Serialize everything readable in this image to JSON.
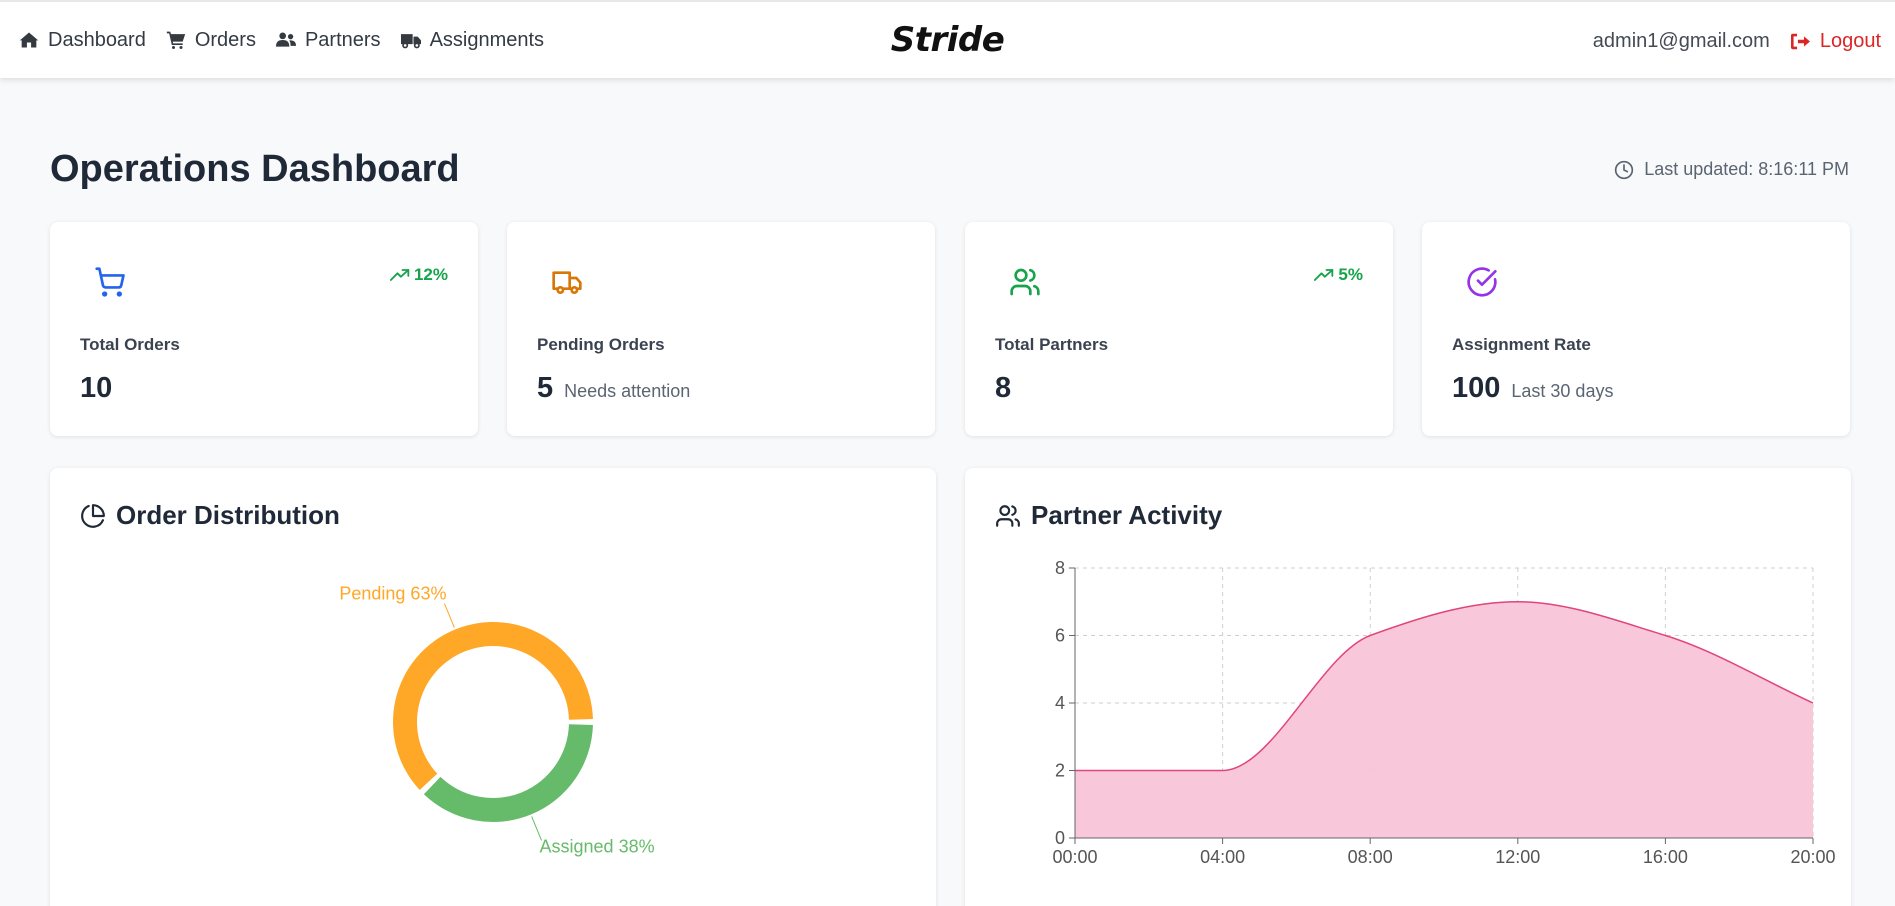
{
  "nav": {
    "items": [
      {
        "label": "Dashboard",
        "icon": "home-icon"
      },
      {
        "label": "Orders",
        "icon": "cart-icon"
      },
      {
        "label": "Partners",
        "icon": "users-icon"
      },
      {
        "label": "Assignments",
        "icon": "truck-icon"
      }
    ],
    "brand": "Stride",
    "user_email": "admin1@gmail.com",
    "logout_label": "Logout"
  },
  "header": {
    "title": "Operations Dashboard",
    "last_updated": "Last updated: 8:16:11 PM"
  },
  "stats": [
    {
      "label": "Total Orders",
      "value": "10",
      "sub": "",
      "trend": "12%",
      "icon": "cart-outline-icon",
      "color": "#2563eb"
    },
    {
      "label": "Pending Orders",
      "value": "5",
      "sub": "Needs attention",
      "trend": "",
      "icon": "truck-outline-icon",
      "color": "#d97706"
    },
    {
      "label": "Total Partners",
      "value": "8",
      "sub": "",
      "trend": "5%",
      "icon": "users-outline-icon",
      "color": "#16a34a"
    },
    {
      "label": "Assignment Rate",
      "value": "100",
      "sub": "Last 30 days",
      "trend": "",
      "icon": "check-circle-icon",
      "color": "#9333ea"
    }
  ],
  "order_panel": {
    "title": "Order Distribution",
    "icon": "pie-chart-icon"
  },
  "partner_panel": {
    "title": "Partner Activity",
    "icon": "users-outline-icon"
  },
  "chart_data": [
    {
      "type": "pie",
      "title": "Order Distribution",
      "slices": [
        {
          "label": "Pending",
          "value": 63,
          "display": "Pending 63%",
          "color": "#ffa726"
        },
        {
          "label": "Assigned",
          "value": 38,
          "display": "Assigned 38%",
          "color": "#66bb6a"
        }
      ]
    },
    {
      "type": "area",
      "title": "Partner Activity",
      "categories": [
        "00:00",
        "04:00",
        "08:00",
        "12:00",
        "16:00",
        "20:00"
      ],
      "values": [
        2,
        2,
        6,
        7,
        6,
        4
      ],
      "ylim": [
        0,
        8
      ],
      "yticks": [
        "0",
        "2",
        "4",
        "6",
        "8"
      ],
      "grid": true,
      "fill_color": "#f8c4d7",
      "line_color": "#e0457b"
    }
  ]
}
